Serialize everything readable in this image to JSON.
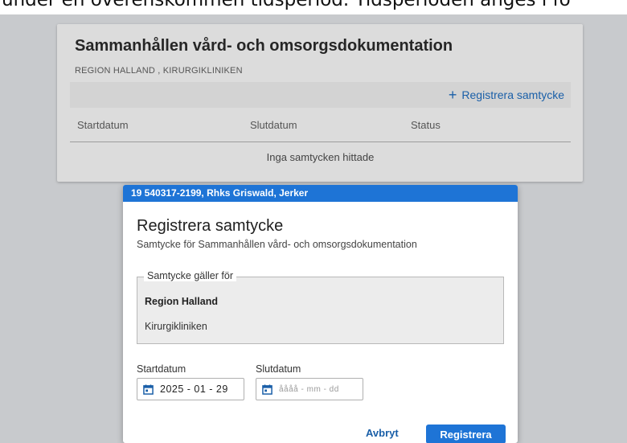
{
  "overlay_text": "under en överenskommen tidsperiod. Tidsperioden anges i fo",
  "background_card": {
    "title": "Sammanhållen vård- och omsorgsdokumentation",
    "subtitle": "REGION HALLAND , KIRURGIKLINIKEN",
    "action_label": "Registrera samtycke",
    "action_icon": "plus-icon",
    "columns": [
      "Startdatum",
      "Slutdatum",
      "Status"
    ],
    "empty_message": "Inga samtycken hittade"
  },
  "modal": {
    "patient_header": "19 540317-2199, Rhks Griswald, Jerker",
    "title": "Registrera samtycke",
    "subtitle": "Samtycke för Sammanhållen vård- och omsorgsdokumentation",
    "scope": {
      "legend": "Samtycke gäller för",
      "region": "Region Halland",
      "clinic": "Kirurgikliniken"
    },
    "start_date": {
      "label": "Startdatum",
      "value": "2025 - 01 - 29",
      "icon": "calendar-icon"
    },
    "end_date": {
      "label": "Slutdatum",
      "placeholder": "åååå - mm - dd",
      "icon": "calendar-icon"
    },
    "cancel_label": "Avbryt",
    "submit_label": "Registrera"
  },
  "colors": {
    "accent": "#1e74d6",
    "link": "#1a5fa8",
    "backdrop": "#c8cacd"
  }
}
